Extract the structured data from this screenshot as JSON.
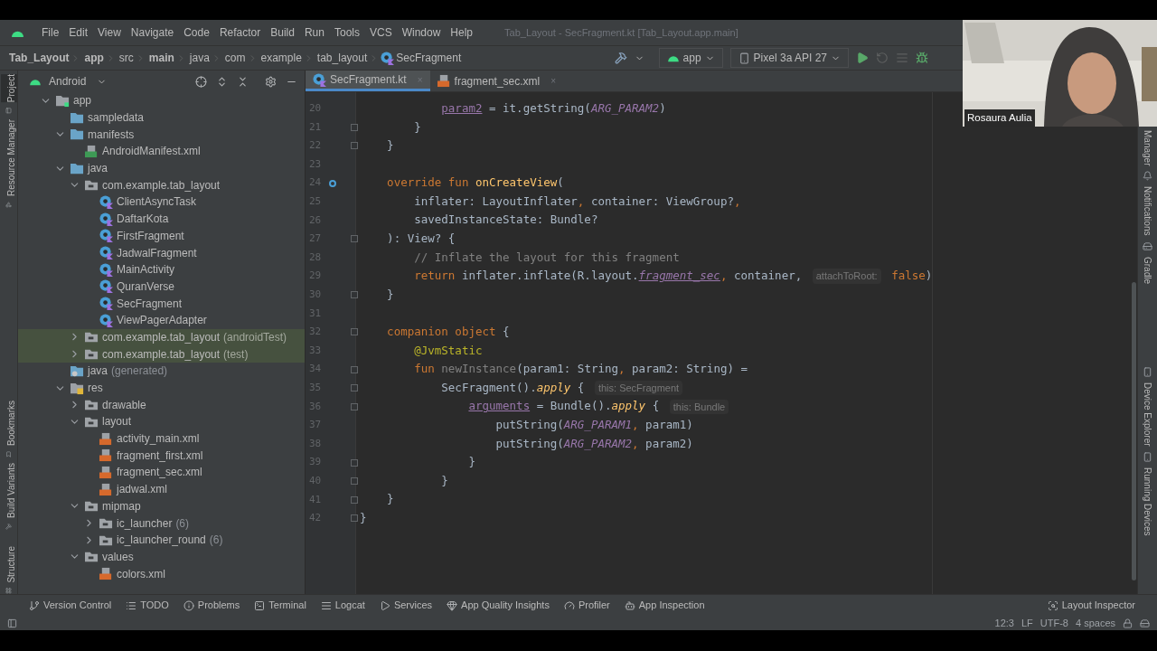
{
  "window": {
    "title": "Tab_Layout - SecFragment.kt [Tab_Layout.app.main]"
  },
  "menu": [
    "File",
    "Edit",
    "View",
    "Navigate",
    "Code",
    "Refactor",
    "Build",
    "Run",
    "Tools",
    "VCS",
    "Window",
    "Help"
  ],
  "breadcrumbs": [
    {
      "label": "Tab_Layout",
      "bold": true
    },
    {
      "label": "app",
      "bold": true
    },
    {
      "label": "src",
      "bold": false
    },
    {
      "label": "main",
      "bold": true
    },
    {
      "label": "java",
      "bold": false
    },
    {
      "label": "com",
      "bold": false
    },
    {
      "label": "example",
      "bold": false
    },
    {
      "label": "tab_layout",
      "bold": false
    },
    {
      "label": "SecFragment",
      "bold": false,
      "kind": "kotlin"
    }
  ],
  "toolbar": {
    "config": "app",
    "device": "Pixel 3a API 27"
  },
  "left_strip": [
    {
      "label": "Project",
      "selected": true
    },
    {
      "label": "Resource Manager",
      "selected": false
    },
    {
      "label": "Bookmarks",
      "selected": false
    },
    {
      "label": "Build Variants",
      "selected": false
    },
    {
      "label": "Structure",
      "selected": false
    }
  ],
  "right_strip": [
    "Manager",
    "Notifications",
    "Gradle",
    "Device Explorer",
    "Running Devices"
  ],
  "tab_close": "×",
  "project": {
    "view": "Android",
    "tree": [
      {
        "label": "app",
        "kind": "module",
        "expanded": true,
        "children": [
          {
            "label": "sampledata",
            "kind": "folder"
          },
          {
            "label": "manifests",
            "kind": "folder",
            "expanded": true,
            "children": [
              {
                "label": "AndroidManifest.xml",
                "kind": "manifest"
              }
            ]
          },
          {
            "label": "java",
            "kind": "folder",
            "expanded": true,
            "children": [
              {
                "label": "com.example.tab_layout",
                "kind": "package",
                "expanded": true,
                "children": [
                  {
                    "label": "ClientAsyncTask",
                    "kind": "kotlin"
                  },
                  {
                    "label": "DaftarKota",
                    "kind": "kotlin"
                  },
                  {
                    "label": "FirstFragment",
                    "kind": "kotlin"
                  },
                  {
                    "label": "JadwalFragment",
                    "kind": "kotlin"
                  },
                  {
                    "label": "MainActivity",
                    "kind": "kotlin"
                  },
                  {
                    "label": "QuranVerse",
                    "kind": "kotlin"
                  },
                  {
                    "label": "SecFragment",
                    "kind": "kotlin"
                  },
                  {
                    "label": "ViewPagerAdapter",
                    "kind": "kotlin"
                  }
                ]
              },
              {
                "label": "com.example.tab_layout",
                "suffix": "(androidTest)",
                "kind": "package",
                "expanded": false,
                "tinted": true
              },
              {
                "label": "com.example.tab_layout",
                "suffix": "(test)",
                "kind": "package",
                "expanded": false,
                "tinted": true
              }
            ]
          },
          {
            "label": "java",
            "suffix": "(generated)",
            "kind": "generated"
          },
          {
            "label": "res",
            "kind": "res",
            "expanded": true,
            "children": [
              {
                "label": "drawable",
                "kind": "package",
                "expanded": false
              },
              {
                "label": "layout",
                "kind": "package",
                "expanded": true,
                "children": [
                  {
                    "label": "activity_main.xml",
                    "kind": "xml"
                  },
                  {
                    "label": "fragment_first.xml",
                    "kind": "xml"
                  },
                  {
                    "label": "fragment_sec.xml",
                    "kind": "xml"
                  },
                  {
                    "label": "jadwal.xml",
                    "kind": "xml"
                  }
                ]
              },
              {
                "label": "mipmap",
                "kind": "package",
                "expanded": true,
                "children": [
                  {
                    "label": "ic_launcher",
                    "suffix": "(6)",
                    "kind": "package",
                    "expanded": false
                  },
                  {
                    "label": "ic_launcher_round",
                    "suffix": "(6)",
                    "kind": "package",
                    "expanded": false
                  }
                ]
              },
              {
                "label": "values",
                "kind": "package",
                "expanded": true,
                "children": [
                  {
                    "label": "colors.xml",
                    "kind": "xml"
                  }
                ]
              }
            ]
          }
        ]
      }
    ]
  },
  "editor_tabs": [
    {
      "label": "SecFragment.kt",
      "kind": "kotlin",
      "selected": true
    },
    {
      "label": "fragment_sec.xml",
      "kind": "xml",
      "selected": false
    }
  ],
  "code": [
    {
      "n": "20",
      "tokens": [
        {
          "text": "            param2",
          "kind": "field"
        },
        {
          "text": " = it.getString(",
          "kind": "plain"
        },
        {
          "text": "ARG_PARAM2",
          "kind": "const"
        },
        {
          "text": ")",
          "kind": "plain"
        }
      ]
    },
    {
      "n": "21",
      "fold": true,
      "tokens": [
        {
          "text": "        }",
          "kind": "plain"
        }
      ]
    },
    {
      "n": "22",
      "fold": true,
      "tokens": [
        {
          "text": "    }",
          "kind": "plain"
        }
      ]
    },
    {
      "n": "23"
    },
    {
      "n": "24",
      "marker": true,
      "tokens": [
        {
          "text": "    override fun ",
          "kind": "kw"
        },
        {
          "text": "onCreateView",
          "kind": "fn"
        },
        {
          "text": "(",
          "kind": "plain"
        }
      ]
    },
    {
      "n": "25",
      "tokens": [
        {
          "text": "        inflater: LayoutInflater",
          "kind": "plain"
        },
        {
          "text": ",",
          "kind": "kw"
        },
        {
          "text": " container: ViewGroup?",
          "kind": "plain"
        },
        {
          "text": ",",
          "kind": "kw"
        }
      ]
    },
    {
      "n": "26",
      "tokens": [
        {
          "text": "        savedInstanceState: Bundle?",
          "kind": "plain"
        }
      ]
    },
    {
      "n": "27",
      "fold": true,
      "tokens": [
        {
          "text": "    ): View? {",
          "kind": "plain"
        }
      ]
    },
    {
      "n": "28",
      "tokens": [
        {
          "text": "        // Inflate the layout for this fragment",
          "kind": "comment"
        }
      ]
    },
    {
      "n": "29",
      "tokens": [
        {
          "text": "        return ",
          "kind": "kw"
        },
        {
          "text": "inflater.inflate(R.layout.",
          "kind": "plain"
        },
        {
          "text": "fragment_sec",
          "kind": "field_italic"
        },
        {
          "text": ",",
          "kind": "kw"
        },
        {
          "text": " container, ",
          "kind": "plain"
        },
        {
          "text": "attachToRoot:",
          "kind": "hint"
        },
        {
          "text": " false",
          "kind": "kw"
        },
        {
          "text": ")",
          "kind": "plain"
        }
      ]
    },
    {
      "n": "30",
      "fold": true,
      "tokens": [
        {
          "text": "    }",
          "kind": "plain"
        }
      ]
    },
    {
      "n": "31"
    },
    {
      "n": "32",
      "fold": true,
      "tokens": [
        {
          "text": "    companion object ",
          "kind": "kw"
        },
        {
          "text": "{",
          "kind": "plain"
        }
      ]
    },
    {
      "n": "33",
      "tokens": [
        {
          "text": "        @JvmStatic",
          "kind": "annotation"
        }
      ]
    },
    {
      "n": "34",
      "fold": true,
      "tokens": [
        {
          "text": "        fun ",
          "kind": "kw"
        },
        {
          "text": "newInstance",
          "kind": "unused"
        },
        {
          "text": "(param1: String",
          "kind": "plain"
        },
        {
          "text": ",",
          "kind": "kw"
        },
        {
          "text": " param2: String) =",
          "kind": "plain"
        }
      ]
    },
    {
      "n": "35",
      "fold": true,
      "tokens": [
        {
          "text": "            SecFragment().",
          "kind": "plain"
        },
        {
          "text": "apply",
          "kind": "call"
        },
        {
          "text": " { ",
          "kind": "plain"
        },
        {
          "text": "this: SecFragment",
          "kind": "hint"
        }
      ]
    },
    {
      "n": "36",
      "fold": true,
      "tokens": [
        {
          "text": "                arguments",
          "kind": "field"
        },
        {
          "text": " = Bundle().",
          "kind": "plain"
        },
        {
          "text": "apply",
          "kind": "call"
        },
        {
          "text": " { ",
          "kind": "plain"
        },
        {
          "text": "this: Bundle",
          "kind": "hint"
        }
      ]
    },
    {
      "n": "37",
      "tokens": [
        {
          "text": "                    putString(",
          "kind": "plain"
        },
        {
          "text": "ARG_PARAM1",
          "kind": "const"
        },
        {
          "text": ",",
          "kind": "kw"
        },
        {
          "text": " param1)",
          "kind": "plain"
        }
      ]
    },
    {
      "n": "38",
      "tokens": [
        {
          "text": "                    putString(",
          "kind": "plain"
        },
        {
          "text": "ARG_PARAM2",
          "kind": "const"
        },
        {
          "text": ",",
          "kind": "kw"
        },
        {
          "text": " param2)",
          "kind": "plain"
        }
      ]
    },
    {
      "n": "39",
      "fold": true,
      "tokens": [
        {
          "text": "                }",
          "kind": "plain"
        }
      ]
    },
    {
      "n": "40",
      "fold": true,
      "tokens": [
        {
          "text": "            }",
          "kind": "plain"
        }
      ]
    },
    {
      "n": "41",
      "fold": true,
      "tokens": [
        {
          "text": "    }",
          "kind": "plain"
        }
      ]
    },
    {
      "n": "42",
      "fold": true,
      "tokens": [
        {
          "text": "}",
          "kind": "plain"
        }
      ]
    }
  ],
  "tool_tabs": [
    {
      "label": "Version Control",
      "kind": "vcs"
    },
    {
      "label": "TODO",
      "kind": "list"
    },
    {
      "label": "Problems",
      "kind": "info"
    },
    {
      "label": "Terminal",
      "kind": "terminal"
    },
    {
      "label": "Logcat",
      "kind": "lines"
    },
    {
      "label": "Services",
      "kind": "play"
    },
    {
      "label": "App Quality Insights",
      "kind": "gem"
    },
    {
      "label": "Profiler",
      "kind": "gauge"
    },
    {
      "label": "App Inspection",
      "kind": "bot"
    }
  ],
  "tool_tabs_right": [
    {
      "label": "Layout Inspector",
      "kind": "inspect"
    }
  ],
  "status": [
    "12:3",
    "LF",
    "UTF-8",
    "4 spaces"
  ],
  "webcam": {
    "kind": "picture",
    "name": "Rosaura Aulia"
  }
}
